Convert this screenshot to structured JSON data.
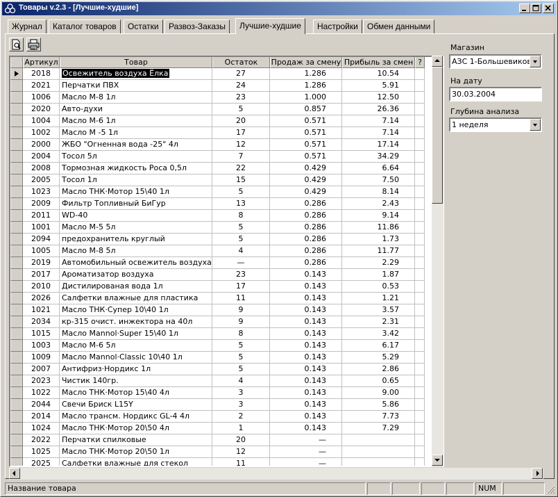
{
  "window": {
    "title": "Товары v.2.3 - [Лучшие-худшие]"
  },
  "tabs": [
    "Журнал",
    "Каталог товаров",
    "Остатки",
    "Развоз-Заказы",
    "Лучшие-худшие",
    "Настройки",
    "Обмен данными"
  ],
  "active_tab": 4,
  "toolbar": {
    "icons": [
      "preview-icon",
      "print-icon"
    ]
  },
  "grid": {
    "headers": [
      "Артикул",
      "Товар",
      "Остаток",
      "Продаж за смену",
      "Прибыль за смен",
      "?"
    ],
    "rows": [
      [
        "2018",
        "Освежитель воздуха  Ёлка",
        "27",
        "1.286",
        "10.54"
      ],
      [
        "2021",
        "Перчатки ПВХ",
        "24",
        "1.286",
        "5.91"
      ],
      [
        "1006",
        "Масло  М-8  1л",
        "23",
        "1.000",
        "12.50"
      ],
      [
        "2020",
        "Авто-духи",
        "5",
        "0.857",
        "26.36"
      ],
      [
        "1004",
        "Масло  М-6  1л",
        "20",
        "0.571",
        "7.14"
      ],
      [
        "1002",
        "Масло  М -5  1л",
        "17",
        "0.571",
        "7.14"
      ],
      [
        "2000",
        "ЖБО \"Огненная вода -25\" 4л",
        "12",
        "0.571",
        "17.14"
      ],
      [
        "2004",
        "Тосол  5л",
        "7",
        "0.571",
        "34.29"
      ],
      [
        "2008",
        "Тормозная жидкость Роса  0,5л",
        "22",
        "0.429",
        "6.64"
      ],
      [
        "2005",
        "Тосол  1л",
        "15",
        "0.429",
        "7.50"
      ],
      [
        "1023",
        "Масло ТНК·Мотор 15\\40 1л",
        "5",
        "0.429",
        "8.14"
      ],
      [
        "2009",
        "Фильтр Топливный  БиГур",
        "13",
        "0.286",
        "2.43"
      ],
      [
        "2011",
        "WD-40",
        "8",
        "0.286",
        "9.14"
      ],
      [
        "1001",
        "Масло  М-5  5л",
        "5",
        "0.286",
        "11.86"
      ],
      [
        "2094",
        "предохранитель круглый",
        "5",
        "0.286",
        "1.73"
      ],
      [
        "1005",
        "Масло  М-8  5л",
        "4",
        "0.286",
        "11.77"
      ],
      [
        "2019",
        "Автомобильный освежитель воздуха",
        "—",
        "0.286",
        "2.29"
      ],
      [
        "2017",
        "Ароматизатор воздуха",
        "23",
        "0.143",
        "1.87"
      ],
      [
        "2010",
        "Дистилированая  вода 1л",
        "17",
        "0.143",
        "0.53"
      ],
      [
        "2026",
        "Салфетки влажные  для пластика",
        "11",
        "0.143",
        "1.21"
      ],
      [
        "1021",
        "Масло ТНК·Супер 10\\40 1л",
        "9",
        "0.143",
        "3.57"
      ],
      [
        "2034",
        "кр-315 очист. инжектора на 40л",
        "9",
        "0.143",
        "2.31"
      ],
      [
        "1015",
        "Масло Mannol·Super 15\\40  1л",
        "8",
        "0.143",
        "3.42"
      ],
      [
        "1003",
        "Масло  М-6  5л",
        "5",
        "0.143",
        "6.17"
      ],
      [
        "1009",
        "Масло Mannol·Classic 10\\40 1л",
        "5",
        "0.143",
        "5.29"
      ],
      [
        "2007",
        "Антифриз·Нордикс  1л",
        "5",
        "0.143",
        "2.86"
      ],
      [
        "2023",
        "Чистик 140гр.",
        "4",
        "0.143",
        "0.65"
      ],
      [
        "1022",
        "Масло ТНК·Мотор 15\\40 4л",
        "3",
        "0.143",
        "9.00"
      ],
      [
        "2044",
        "Свечи Бриск L15Y",
        "3",
        "0.143",
        "5.86"
      ],
      [
        "2014",
        "Масло трансм. Нордикс GL-4 4л",
        "2",
        "0.143",
        "7.73"
      ],
      [
        "1024",
        "Масло ТНК·Мотор 20\\50 4л",
        "1",
        "0.143",
        "7.29"
      ],
      [
        "2022",
        "Перчатки спилковые",
        "20",
        "—",
        ""
      ],
      [
        "1025",
        "Масло ТНК·Мотор 20\\50 1л",
        "12",
        "—",
        ""
      ],
      [
        "2025",
        "Салфетки влажные  для стекол",
        "11",
        "—",
        ""
      ]
    ],
    "selected_row": 0
  },
  "side": {
    "shop_label": "Магазин",
    "shop_value": "АЗС 1-Большевиков",
    "date_label": "На дату",
    "date_value": "30.03.2004",
    "depth_label": "Глубина анализа",
    "depth_value": "1 неделя"
  },
  "status": {
    "text": "Название товара",
    "num": "NUM"
  }
}
